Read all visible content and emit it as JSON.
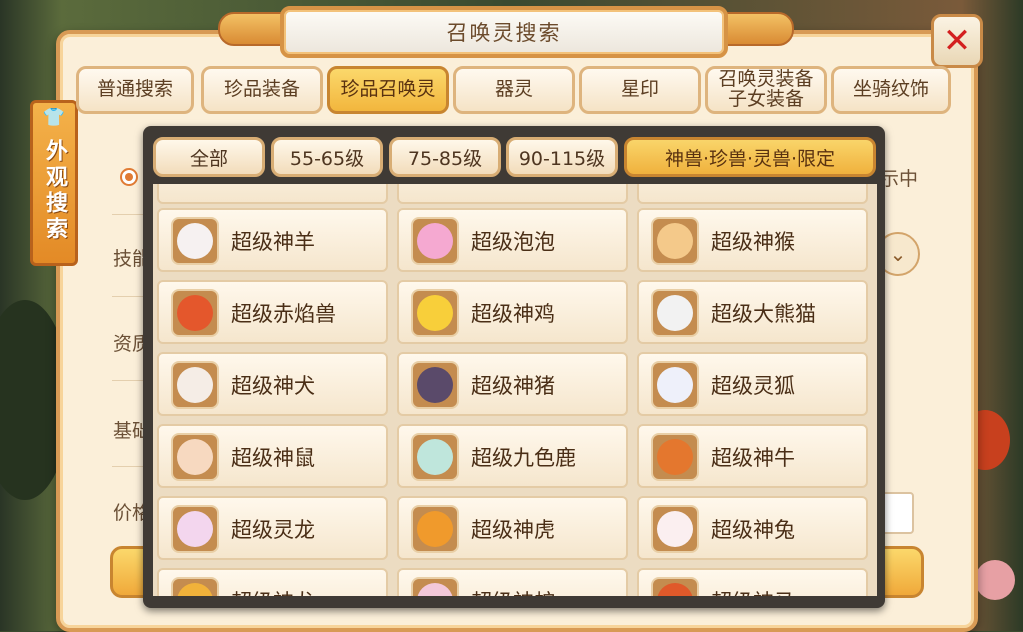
{
  "window": {
    "title": "召唤灵搜索"
  },
  "side_tag": {
    "label": "外观搜索"
  },
  "tabs": [
    {
      "label": "普通搜索",
      "active": false
    },
    {
      "label": "珍品装备",
      "active": false
    },
    {
      "label": "珍品召唤灵",
      "active": true
    },
    {
      "label": "器灵",
      "active": false
    },
    {
      "label": "星印",
      "active": false
    },
    {
      "label": "召唤灵装备\n子女装备",
      "active": false
    },
    {
      "label": "坐骑纹饰",
      "active": false
    }
  ],
  "underlying_labels": {
    "skill": "技能",
    "aptitude": "资质",
    "base": "基础",
    "price": "价格",
    "tail": "示中"
  },
  "level_filters": [
    {
      "label": "全部",
      "active": false
    },
    {
      "label": "55-65级",
      "active": false
    },
    {
      "label": "75-85级",
      "active": false
    },
    {
      "label": "90-115级",
      "active": false
    },
    {
      "label": "神兽·珍兽·灵兽·限定",
      "active": true
    }
  ],
  "pets": [
    {
      "name": "超级神羊",
      "icon": "sheep-icon",
      "color": "#f6f1f1"
    },
    {
      "name": "超级泡泡",
      "icon": "bubble-icon",
      "color": "#f5a9d1"
    },
    {
      "name": "超级神猴",
      "icon": "monkey-icon",
      "color": "#f4c98a"
    },
    {
      "name": "超级赤焰兽",
      "icon": "fire-beast-icon",
      "color": "#e4572c"
    },
    {
      "name": "超级神鸡",
      "icon": "rooster-icon",
      "color": "#f8cf3a"
    },
    {
      "name": "超级大熊猫",
      "icon": "panda-icon",
      "color": "#f2f2f2"
    },
    {
      "name": "超级神犬",
      "icon": "dog-icon",
      "color": "#f5ede6"
    },
    {
      "name": "超级神猪",
      "icon": "pig-icon",
      "color": "#5a4a6a"
    },
    {
      "name": "超级灵狐",
      "icon": "fox-icon",
      "color": "#eef0fa"
    },
    {
      "name": "超级神鼠",
      "icon": "mouse-icon",
      "color": "#f7d9c0"
    },
    {
      "name": "超级九色鹿",
      "icon": "deer-icon",
      "color": "#bfe6dc"
    },
    {
      "name": "超级神牛",
      "icon": "ox-icon",
      "color": "#e4772e"
    },
    {
      "name": "超级灵龙",
      "icon": "dragon-icon",
      "color": "#f3d6ee"
    },
    {
      "name": "超级神虎",
      "icon": "tiger-icon",
      "color": "#f09a2c"
    },
    {
      "name": "超级神兔",
      "icon": "rabbit-icon",
      "color": "#fbeff0"
    },
    {
      "name": "超级神龙",
      "icon": "dragon-icon",
      "color": "#f1b23a"
    },
    {
      "name": "超级神蛇",
      "icon": "snake-icon",
      "color": "#f3c8d9"
    },
    {
      "name": "超级神马",
      "icon": "horse-icon",
      "color": "#e0592a"
    }
  ]
}
